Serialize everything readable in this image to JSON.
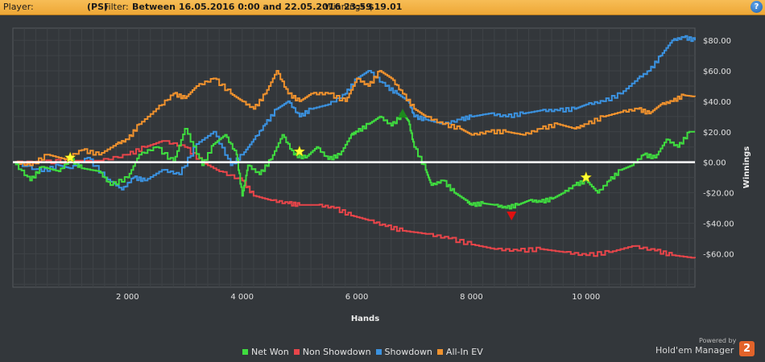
{
  "header": {
    "player_label": "Player:",
    "site": "(PS)",
    "filter_label": "Filter:",
    "filter_value": "Between 16.05.2016 0:00 and 22.05.2016 23:59",
    "winnings_label": "Winnings:",
    "winnings_value": "$19.01",
    "help_icon": "?"
  },
  "footer": {
    "powered_by": "Powered by",
    "brand": "Hold'em Manager",
    "brand_badge": "2"
  },
  "colors": {
    "net_won": "#3fdc3f",
    "non_showdown": "#e8454a",
    "showdown": "#3b92e0",
    "all_in_ev": "#f0922e",
    "zero_line": "#ffffff",
    "grid": "#3f4347",
    "background": "#33373b",
    "header_bg": "#f2b144"
  },
  "chart_data": {
    "type": "line",
    "title": "",
    "xlabel": "Hands",
    "ylabel": "Winnings",
    "xlim": [
      0,
      11900
    ],
    "ylim": [
      -82,
      88
    ],
    "x_ticks": [
      {
        "value": 2000,
        "label": "2 000"
      },
      {
        "value": 4000,
        "label": "4 000"
      },
      {
        "value": 6000,
        "label": "6 000"
      },
      {
        "value": 8000,
        "label": "8 000"
      },
      {
        "value": 10000,
        "label": "10 000"
      }
    ],
    "y_ticks": [
      {
        "value": 80,
        "label": "$80.00"
      },
      {
        "value": 60,
        "label": "$60.00"
      },
      {
        "value": 40,
        "label": "$40.00"
      },
      {
        "value": 20,
        "label": "$20.00"
      },
      {
        "value": 0,
        "label": "$0.00"
      },
      {
        "value": -20,
        "label": "-$20.00"
      },
      {
        "value": -40,
        "label": "-$40.00"
      },
      {
        "value": -60,
        "label": "-$60.00"
      }
    ],
    "grid": true,
    "legend_position": "bottom-center",
    "series": [
      {
        "name": "Net Won",
        "color": "#3fdc3f",
        "x": [
          0,
          300,
          500,
          800,
          1000,
          1200,
          1500,
          1700,
          2000,
          2200,
          2500,
          2800,
          3000,
          3300,
          3500,
          3700,
          3900,
          4000,
          4100,
          4300,
          4500,
          4700,
          4900,
          5100,
          5300,
          5500,
          5700,
          5900,
          6000,
          6200,
          6400,
          6600,
          6800,
          6900,
          7000,
          7200,
          7300,
          7500,
          7700,
          7900,
          8000,
          8200,
          8400,
          8600,
          8800,
          9000,
          9200,
          9400,
          9600,
          9800,
          10000,
          10200,
          10400,
          10600,
          10800,
          11000,
          11200,
          11400,
          11600,
          11800,
          11900
        ],
        "y": [
          0,
          -12,
          -3,
          -6,
          2,
          -4,
          -6,
          -15,
          -10,
          5,
          10,
          0,
          22,
          -2,
          12,
          18,
          5,
          -22,
          -2,
          -8,
          2,
          18,
          5,
          3,
          10,
          2,
          5,
          18,
          20,
          25,
          30,
          24,
          32,
          27,
          10,
          -5,
          -15,
          -12,
          -20,
          -25,
          -28,
          -27,
          -28,
          -30,
          -28,
          -25,
          -26,
          -24,
          -20,
          -15,
          -12,
          -20,
          -12,
          -5,
          -2,
          5,
          3,
          15,
          10,
          20,
          20
        ]
      },
      {
        "name": "Non Showdown",
        "color": "#e8454a",
        "x": [
          0,
          500,
          1000,
          1500,
          2000,
          2300,
          2600,
          3000,
          3300,
          3600,
          4000,
          4200,
          4500,
          4800,
          5000,
          5300,
          5600,
          5900,
          6200,
          6500,
          6800,
          7200,
          7600,
          8000,
          8400,
          8800,
          9200,
          9600,
          10000,
          10400,
          10800,
          11200,
          11500,
          11900
        ],
        "y": [
          0,
          0,
          1,
          1,
          5,
          10,
          14,
          10,
          0,
          -6,
          -12,
          -22,
          -25,
          -27,
          -28,
          -28,
          -30,
          -35,
          -38,
          -42,
          -45,
          -47,
          -50,
          -54,
          -57,
          -58,
          -57,
          -59,
          -61,
          -59,
          -55,
          -58,
          -61,
          -63
        ]
      },
      {
        "name": "Showdown",
        "color": "#3b92e0",
        "x": [
          0,
          500,
          800,
          1000,
          1300,
          1600,
          1900,
          2100,
          2300,
          2600,
          2900,
          3200,
          3500,
          3800,
          4000,
          4200,
          4400,
          4600,
          4800,
          5000,
          5200,
          5500,
          5800,
          6000,
          6200,
          6500,
          6700,
          6900,
          7000,
          7200,
          7500,
          7800,
          8000,
          8300,
          8600,
          8900,
          9200,
          9500,
          9800,
          10000,
          10300,
          10600,
          10900,
          11100,
          11300,
          11500,
          11700,
          11900
        ],
        "y": [
          0,
          -6,
          -2,
          -4,
          3,
          -10,
          -18,
          -10,
          -12,
          -5,
          -8,
          12,
          20,
          -2,
          5,
          15,
          25,
          35,
          40,
          30,
          35,
          38,
          45,
          55,
          60,
          50,
          45,
          40,
          30,
          28,
          25,
          28,
          30,
          32,
          30,
          32,
          34,
          34,
          35,
          38,
          40,
          45,
          55,
          60,
          70,
          80,
          82,
          80
        ]
      },
      {
        "name": "All-In EV",
        "color": "#f0922e",
        "x": [
          0,
          300,
          600,
          900,
          1200,
          1500,
          1800,
          2000,
          2200,
          2500,
          2800,
          3000,
          3200,
          3500,
          3800,
          4000,
          4200,
          4400,
          4600,
          4800,
          5000,
          5200,
          5500,
          5800,
          6000,
          6200,
          6400,
          6600,
          6800,
          7000,
          7200,
          7500,
          7800,
          8000,
          8300,
          8600,
          8900,
          9200,
          9500,
          9800,
          10000,
          10300,
          10600,
          10900,
          11100,
          11300,
          11500,
          11700,
          11900
        ],
        "y": [
          0,
          -2,
          5,
          2,
          8,
          5,
          12,
          15,
          25,
          35,
          45,
          42,
          50,
          55,
          45,
          40,
          35,
          45,
          60,
          45,
          40,
          45,
          45,
          40,
          55,
          50,
          60,
          55,
          45,
          35,
          30,
          25,
          22,
          18,
          20,
          20,
          18,
          22,
          25,
          22,
          25,
          30,
          33,
          35,
          32,
          38,
          40,
          44,
          43
        ]
      }
    ],
    "markers": [
      {
        "type": "star",
        "x": 1000,
        "y": 3,
        "color": "#ffff33"
      },
      {
        "type": "star",
        "x": 5000,
        "y": 7,
        "color": "#ffff33"
      },
      {
        "type": "star",
        "x": 10000,
        "y": -10,
        "color": "#ffff33"
      },
      {
        "type": "triangle-up",
        "x": 6800,
        "y": 32,
        "color": "#1d8a1d"
      },
      {
        "type": "triangle-down",
        "x": 8700,
        "y": -35,
        "color": "#e01010"
      }
    ]
  }
}
